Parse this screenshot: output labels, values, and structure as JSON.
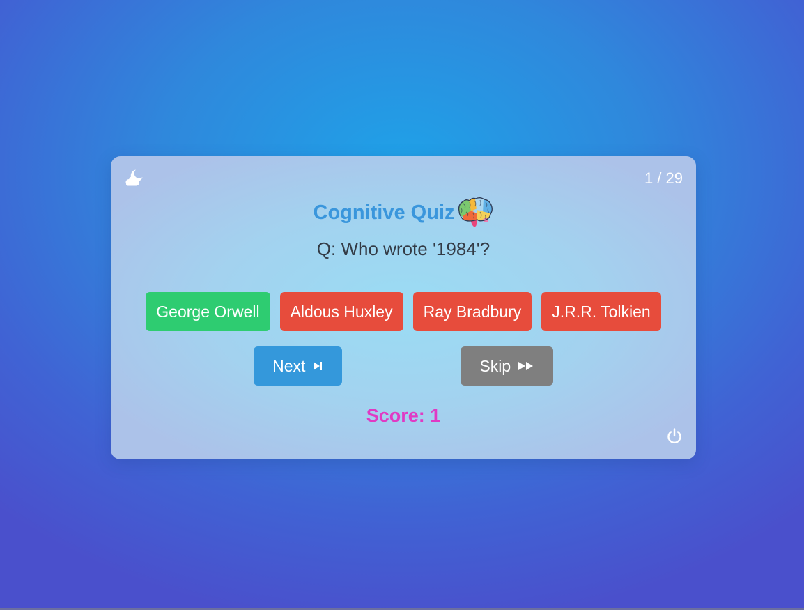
{
  "quiz": {
    "counter": "1 / 29",
    "title": "Cognitive Quiz",
    "question": "Q: Who wrote '1984'?",
    "answers": [
      {
        "label": "George Orwell",
        "state": "correct"
      },
      {
        "label": "Aldous Huxley",
        "state": "wrong"
      },
      {
        "label": "Ray Bradbury",
        "state": "wrong"
      },
      {
        "label": "J.R.R. Tolkien",
        "state": "wrong"
      }
    ],
    "next_label": "Next",
    "skip_label": "Skip",
    "score": "Score: 1"
  },
  "icons": {
    "theme": "moon-cloud-icon",
    "title": "brain-icon",
    "next": "next-track-icon",
    "skip": "fast-forward-icon",
    "power": "power-icon"
  },
  "colors": {
    "correct": "#2ecc71",
    "wrong": "#e74c3c",
    "next": "#3498db",
    "skip": "#7f7f7f",
    "title": "#3a96dc",
    "score": "#e03ac4"
  }
}
